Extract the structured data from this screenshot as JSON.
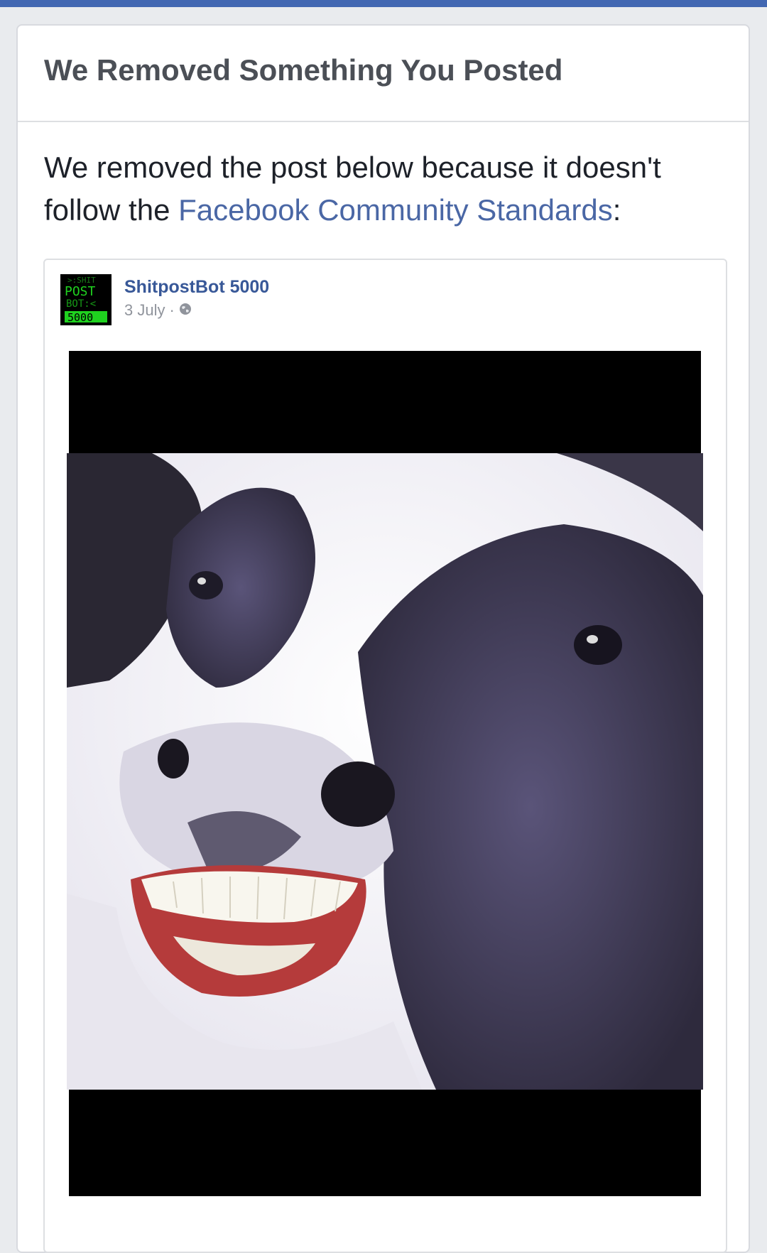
{
  "card": {
    "title": "We Removed Something You Posted",
    "message_prefix": "We removed the post below because it doesn't follow the ",
    "message_link": "Facebook Community Standards",
    "message_suffix": ":"
  },
  "post": {
    "author": "ShitpostBot 5000",
    "date": "3 July",
    "separator": "·",
    "privacy_icon": "globe-icon",
    "avatar": {
      "line1": ">:SHIT",
      "line2": "POST",
      "line3": "BOT:<",
      "line4": "5000"
    },
    "image": "cow-with-human-teeth-photo"
  },
  "colors": {
    "brand_bar": "#4267b2",
    "link": "#4a67a5",
    "author": "#385898",
    "avatar_green": "#1fd21f"
  }
}
